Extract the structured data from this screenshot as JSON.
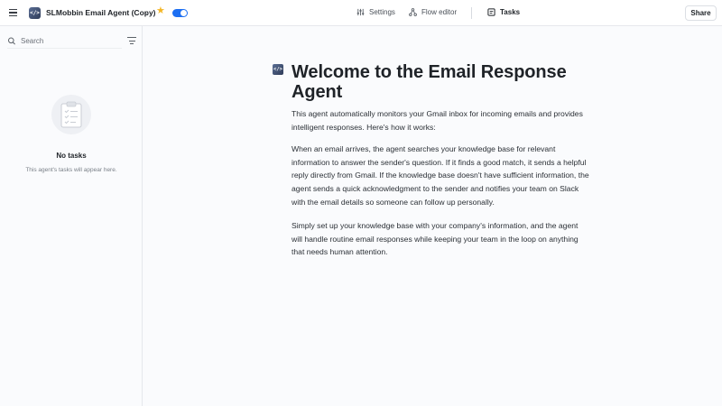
{
  "topbar": {
    "agent_icon_glyph": "</>",
    "agent_title": "SLMobbin Email Agent (Copy)",
    "agent_title_chevron": "⌄",
    "favorite_glyph": "★",
    "enabled": true,
    "nav": {
      "settings_label": "Settings",
      "flow_editor_label": "Flow editor",
      "tasks_label": "Tasks"
    },
    "share_label": "Share"
  },
  "sidebar": {
    "search_placeholder": "Search",
    "empty_title": "No tasks",
    "empty_subtitle": "This agent's tasks will appear here."
  },
  "main": {
    "icon_glyph": "</>",
    "title": "Welcome to the Email Response Agent",
    "paragraphs": [
      "This agent automatically monitors your Gmail inbox for incoming emails and provides intelligent responses. Here's how it works:",
      "When an email arrives, the agent searches your knowledge base for relevant information to answer the sender's question. If it finds a good match, it sends a helpful reply directly from Gmail. If the knowledge base doesn't have sufficient information, the agent sends a quick acknowledgment to the sender and notifies your team on Slack with the email details so someone can follow up personally.",
      "Simply set up your knowledge base with your company's information, and the agent will handle routine email responses while keeping your team in the loop on anything that needs human attention."
    ]
  },
  "colors": {
    "accent": "#1d6ff2",
    "star": "#f4b625",
    "background": "#fafbfd"
  }
}
